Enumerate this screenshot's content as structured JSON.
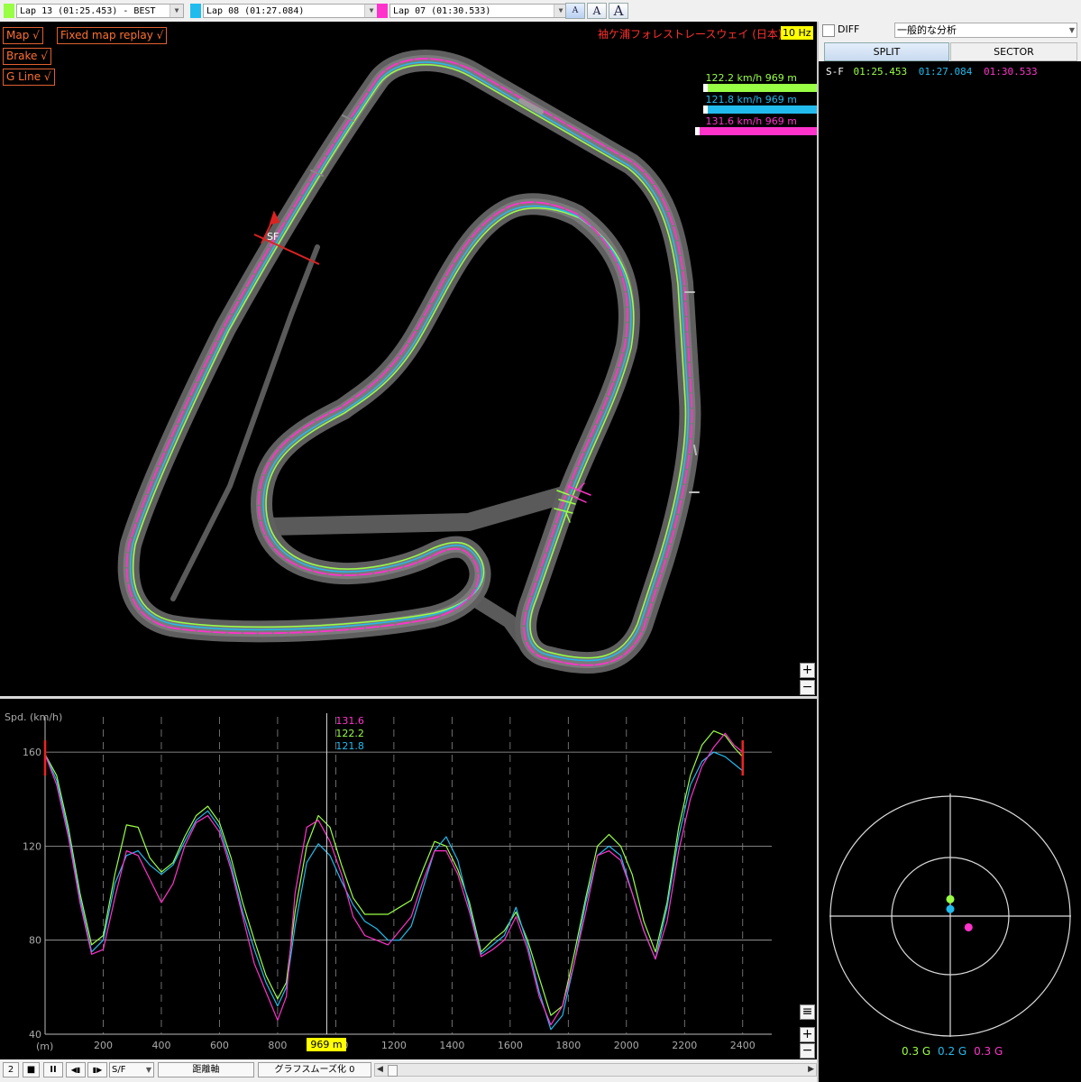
{
  "laps": [
    {
      "label": "Lap 13 (01:25.453) - BEST",
      "color": "#99ff44"
    },
    {
      "label": "Lap 08 (01:27.084)",
      "color": "#22bbee"
    },
    {
      "label": "Lap 07 (01:30.533)",
      "color": "#ff33cc"
    }
  ],
  "font_buttons": [
    "A",
    "A",
    "A"
  ],
  "map": {
    "toggles": {
      "map": "Map √",
      "fixed_replay": "Fixed map replay √",
      "brake": "Brake √",
      "gline": "G Line √"
    },
    "track_name": "袖ケ浦フォレストレースウェイ (日本)",
    "rate": "10 Hz",
    "sf_label": "SF",
    "speeds": [
      {
        "text": "122.2 km/h  969 m",
        "color": "#99ff44",
        "bar_fraction": 0.93
      },
      {
        "text": "121.8 km/h  969 m",
        "color": "#22bbee",
        "bar_fraction": 0.93
      },
      {
        "text": "131.6 km/h  969 m",
        "color": "#ff33cc",
        "bar_fraction": 0.99
      }
    ],
    "zoom_in": "+",
    "zoom_out": "−"
  },
  "chart_data": {
    "type": "line",
    "ylabel": "Spd. (km/h)",
    "xlabel": "(m)",
    "xlim": [
      0,
      2500
    ],
    "ylim": [
      40,
      175
    ],
    "yticks": [
      40,
      80,
      120,
      160
    ],
    "xticks": [
      200,
      400,
      600,
      800,
      1000,
      1200,
      1400,
      1600,
      1800,
      2000,
      2200,
      2400
    ],
    "cursor_x": 969,
    "cursor_label": "969 m",
    "cursor_values": [
      {
        "text": "131.6",
        "color": "#ff33cc"
      },
      {
        "text": "122.2",
        "color": "#99ff44"
      },
      {
        "text": "121.8",
        "color": "#22bbee"
      }
    ],
    "series": [
      {
        "name": "Lap 13 (01:25.453) - BEST",
        "color": "#99ff44",
        "x": [
          0,
          40,
          80,
          120,
          160,
          200,
          240,
          280,
          320,
          360,
          400,
          440,
          480,
          520,
          560,
          600,
          640,
          680,
          720,
          760,
          800,
          830,
          860,
          900,
          940,
          980,
          1020,
          1060,
          1100,
          1140,
          1180,
          1220,
          1260,
          1300,
          1340,
          1380,
          1420,
          1460,
          1500,
          1540,
          1580,
          1620,
          1660,
          1700,
          1740,
          1780,
          1820,
          1860,
          1900,
          1940,
          1980,
          2020,
          2060,
          2100,
          2140,
          2180,
          2220,
          2260,
          2300,
          2340,
          2370,
          2400
        ],
        "y": [
          159,
          150,
          128,
          100,
          78,
          82,
          108,
          129,
          128,
          115,
          109,
          113,
          124,
          133,
          137,
          130,
          115,
          96,
          80,
          65,
          55,
          62,
          92,
          120,
          133,
          128,
          112,
          98,
          91,
          91,
          91,
          94,
          97,
          110,
          122,
          120,
          110,
          96,
          75,
          80,
          84,
          92,
          80,
          64,
          48,
          52,
          74,
          98,
          120,
          125,
          120,
          108,
          88,
          75,
          96,
          128,
          150,
          163,
          169,
          167,
          162,
          158
        ]
      },
      {
        "name": "Lap 08 (01:27.084)",
        "color": "#22bbee",
        "x": [
          0,
          40,
          80,
          120,
          160,
          200,
          240,
          280,
          320,
          360,
          400,
          440,
          480,
          520,
          560,
          600,
          640,
          680,
          720,
          760,
          800,
          830,
          860,
          900,
          940,
          980,
          1020,
          1060,
          1100,
          1140,
          1180,
          1220,
          1260,
          1300,
          1340,
          1380,
          1420,
          1460,
          1500,
          1540,
          1580,
          1620,
          1660,
          1700,
          1740,
          1780,
          1820,
          1860,
          1900,
          1940,
          1980,
          2020,
          2060,
          2100,
          2140,
          2180,
          2220,
          2260,
          2300,
          2340,
          2370,
          2400
        ],
        "y": [
          159,
          148,
          126,
          98,
          75,
          80,
          104,
          116,
          118,
          112,
          108,
          112,
          122,
          131,
          135,
          128,
          112,
          92,
          76,
          62,
          52,
          60,
          86,
          113,
          121,
          116,
          105,
          95,
          88,
          85,
          80,
          80,
          86,
          102,
          118,
          124,
          114,
          94,
          74,
          78,
          82,
          94,
          78,
          58,
          42,
          48,
          70,
          96,
          116,
          120,
          116,
          100,
          84,
          72,
          94,
          124,
          146,
          156,
          160,
          158,
          155,
          152
        ]
      },
      {
        "name": "Lap 07 (01:30.533)",
        "color": "#ff33cc",
        "x": [
          0,
          40,
          80,
          120,
          160,
          200,
          240,
          280,
          320,
          360,
          400,
          440,
          480,
          520,
          560,
          600,
          640,
          680,
          720,
          760,
          800,
          830,
          860,
          900,
          940,
          980,
          1020,
          1060,
          1100,
          1140,
          1180,
          1220,
          1260,
          1300,
          1340,
          1380,
          1420,
          1460,
          1500,
          1540,
          1580,
          1620,
          1660,
          1700,
          1740,
          1780,
          1820,
          1860,
          1900,
          1940,
          1980,
          2020,
          2060,
          2100,
          2140,
          2180,
          2220,
          2260,
          2300,
          2340,
          2370,
          2400
        ],
        "y": [
          159,
          146,
          124,
          96,
          74,
          76,
          98,
          118,
          116,
          106,
          96,
          104,
          120,
          130,
          133,
          126,
          110,
          90,
          70,
          58,
          46,
          56,
          100,
          128,
          131,
          122,
          108,
          90,
          82,
          80,
          78,
          84,
          90,
          105,
          118,
          118,
          108,
          92,
          73,
          76,
          80,
          90,
          76,
          56,
          44,
          52,
          70,
          92,
          116,
          118,
          114,
          100,
          84,
          72,
          88,
          118,
          140,
          154,
          162,
          168,
          163,
          160
        ]
      }
    ]
  },
  "chart_buttons": {
    "menu": "≡",
    "zoom_in": "+",
    "zoom_out": "−"
  },
  "toolbar": {
    "speed": "2",
    "stop": "■",
    "pause": "II",
    "first": "◀▮",
    "last": "▮▶",
    "segment": "S/F",
    "axis": "距離軸",
    "smooth": "グラフスムーズ化  0",
    "scroll_left": "◀",
    "scroll_right": "▶"
  },
  "right": {
    "diff_label": "DIFF",
    "analysis_select": "一般的な分析",
    "tab_split": "SPLIT",
    "tab_sector": "SECTOR",
    "split_row": {
      "label": "S-F",
      "times": [
        {
          "text": "01:25.453",
          "color": "#99ff44"
        },
        {
          "text": "01:27.084",
          "color": "#22bbee"
        },
        {
          "text": "01:30.533",
          "color": "#ff33cc"
        }
      ]
    },
    "g_values": [
      {
        "text": "0.3 G",
        "color": "#99ff44",
        "gx": 0.0,
        "gy": 0.12
      },
      {
        "text": "0.2 G",
        "color": "#22bbee",
        "gx": 0.0,
        "gy": 0.05
      },
      {
        "text": "0.3 G",
        "color": "#ff33cc",
        "gx": 0.13,
        "gy": -0.08
      }
    ]
  }
}
